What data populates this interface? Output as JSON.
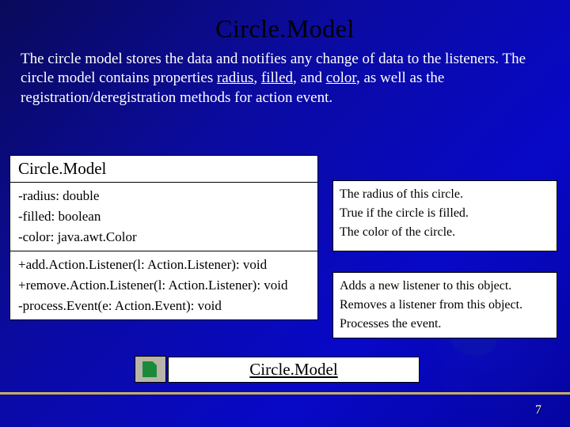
{
  "title": "Circle.Model",
  "description_prefix": "The circle model stores the data and notifies any change of data to the listeners. The circle model contains properties ",
  "prop1": "radius",
  "prop2": "filled",
  "prop3": "color",
  "description_suffix": ", as well as the registration/deregistration methods for action event.",
  "uml": {
    "class_name": "Circle.Model",
    "attrs": [
      "-radius: double",
      "-filled: boolean",
      "-color: java.awt.Color"
    ],
    "ops": [
      "+add.Action.Listener(l: Action.Listener): void",
      "+remove.Action.Listener(l: Action.Listener): void",
      "-process.Event(e: Action.Event): void"
    ]
  },
  "attr_desc": [
    "The radius of this circle.",
    "True if the circle is filled.",
    "The color of the circle."
  ],
  "op_desc": [
    "Adds a new listener to this object.",
    "Removes a listener from this object.",
    "Processes the event."
  ],
  "link_text": "Circle.Model",
  "page_number": "7"
}
